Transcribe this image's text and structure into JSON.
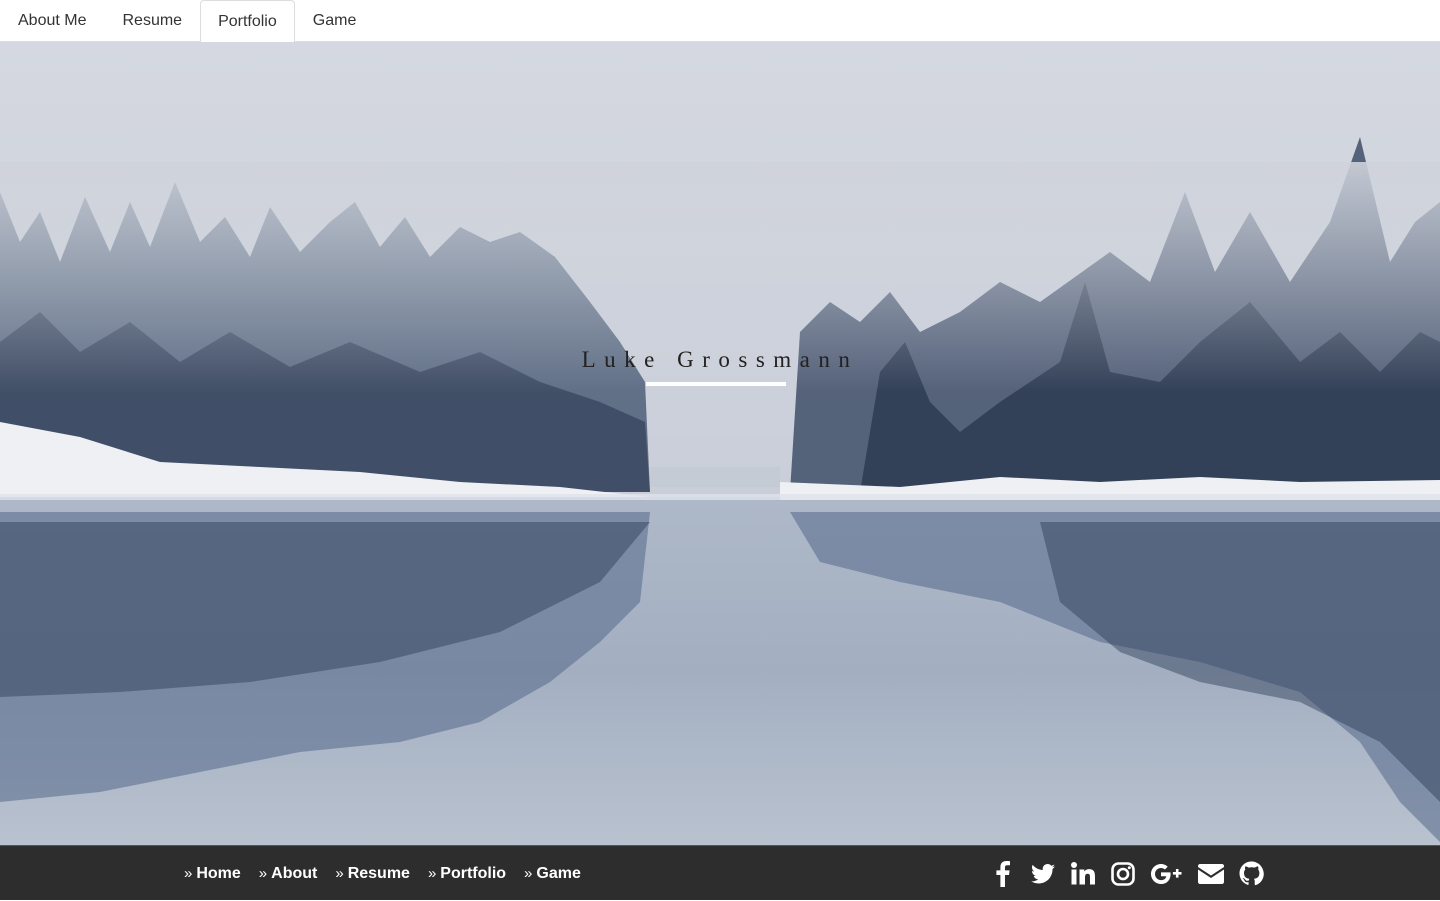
{
  "topnav": {
    "tabs": [
      {
        "label": "About Me"
      },
      {
        "label": "Resume"
      },
      {
        "label": "Portfolio",
        "active": true
      },
      {
        "label": "Game"
      }
    ]
  },
  "hero": {
    "title": "Luke Grossmann"
  },
  "footer": {
    "links": [
      {
        "label": "Home"
      },
      {
        "label": "About"
      },
      {
        "label": "Resume"
      },
      {
        "label": "Portfolio"
      },
      {
        "label": "Game"
      }
    ],
    "social_icons": [
      "facebook-icon",
      "twitter-icon",
      "linkedin-icon",
      "instagram-icon",
      "google-plus-icon",
      "envelope-icon",
      "github-icon"
    ]
  }
}
